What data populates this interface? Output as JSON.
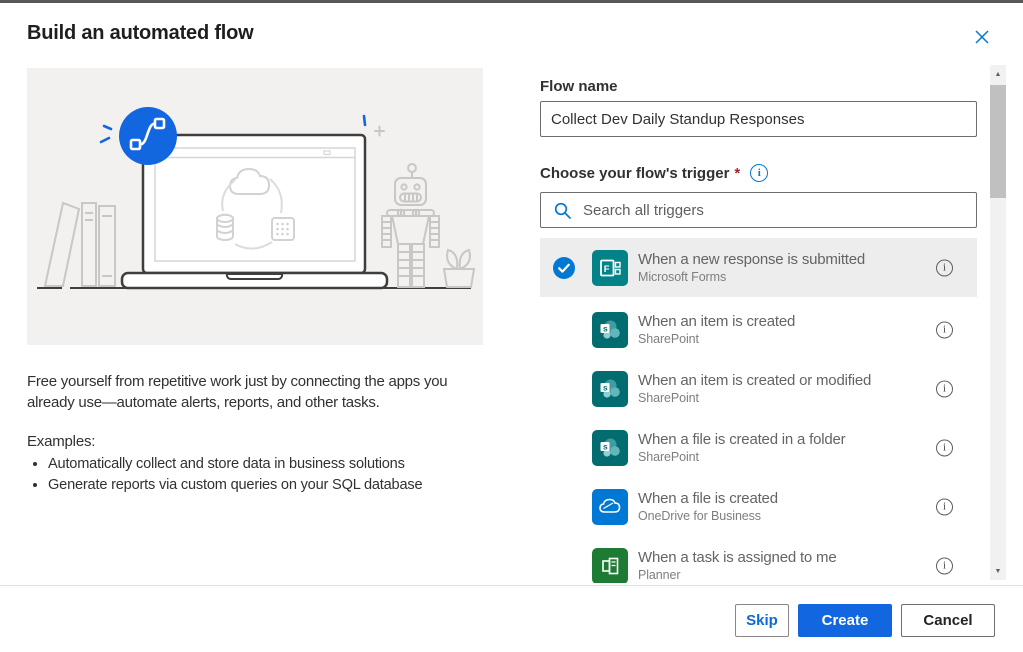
{
  "dialog": {
    "title": "Build an automated flow"
  },
  "left_panel": {
    "description": "Free yourself from repetitive work just by connecting the apps you already use—automate alerts, reports, and other tasks.",
    "examples_label": "Examples:",
    "examples": [
      "Automatically collect and store data in business solutions",
      "Generate reports via custom queries on your SQL database"
    ]
  },
  "form": {
    "flow_name_label": "Flow name",
    "flow_name_value": "Collect Dev Daily Standup Responses",
    "trigger_label": "Choose your flow's trigger",
    "required_marker": "*",
    "search_placeholder": "Search all triggers"
  },
  "triggers": [
    {
      "title": "When a new response is submitted",
      "service": "Microsoft Forms",
      "icon": "microsoft-forms",
      "color": "#038387",
      "selected": true
    },
    {
      "title": "When an item is created",
      "service": "SharePoint",
      "icon": "sharepoint",
      "color": "#036c70",
      "selected": false
    },
    {
      "title": "When an item is created or modified",
      "service": "SharePoint",
      "icon": "sharepoint",
      "color": "#036c70",
      "selected": false
    },
    {
      "title": "When a file is created in a folder",
      "service": "SharePoint",
      "icon": "sharepoint",
      "color": "#036c70",
      "selected": false
    },
    {
      "title": "When a file is created",
      "service": "OneDrive for Business",
      "icon": "onedrive",
      "color": "#0078d4",
      "selected": false
    },
    {
      "title": "When a task is assigned to me",
      "service": "Planner",
      "icon": "planner",
      "color": "#1e7b34",
      "selected": false
    }
  ],
  "footer": {
    "skip_label": "Skip",
    "create_label": "Create",
    "cancel_label": "Cancel"
  },
  "icons": {
    "info": "i",
    "scroll_up": "▲",
    "scroll_down": "▼"
  },
  "colors": {
    "accent_blue": "#0078d4",
    "create_button_blue": "#1267e0",
    "selected_row_bg": "#ededed",
    "required_red": "#a4262c",
    "illustration_bg": "#f2f1f0"
  }
}
